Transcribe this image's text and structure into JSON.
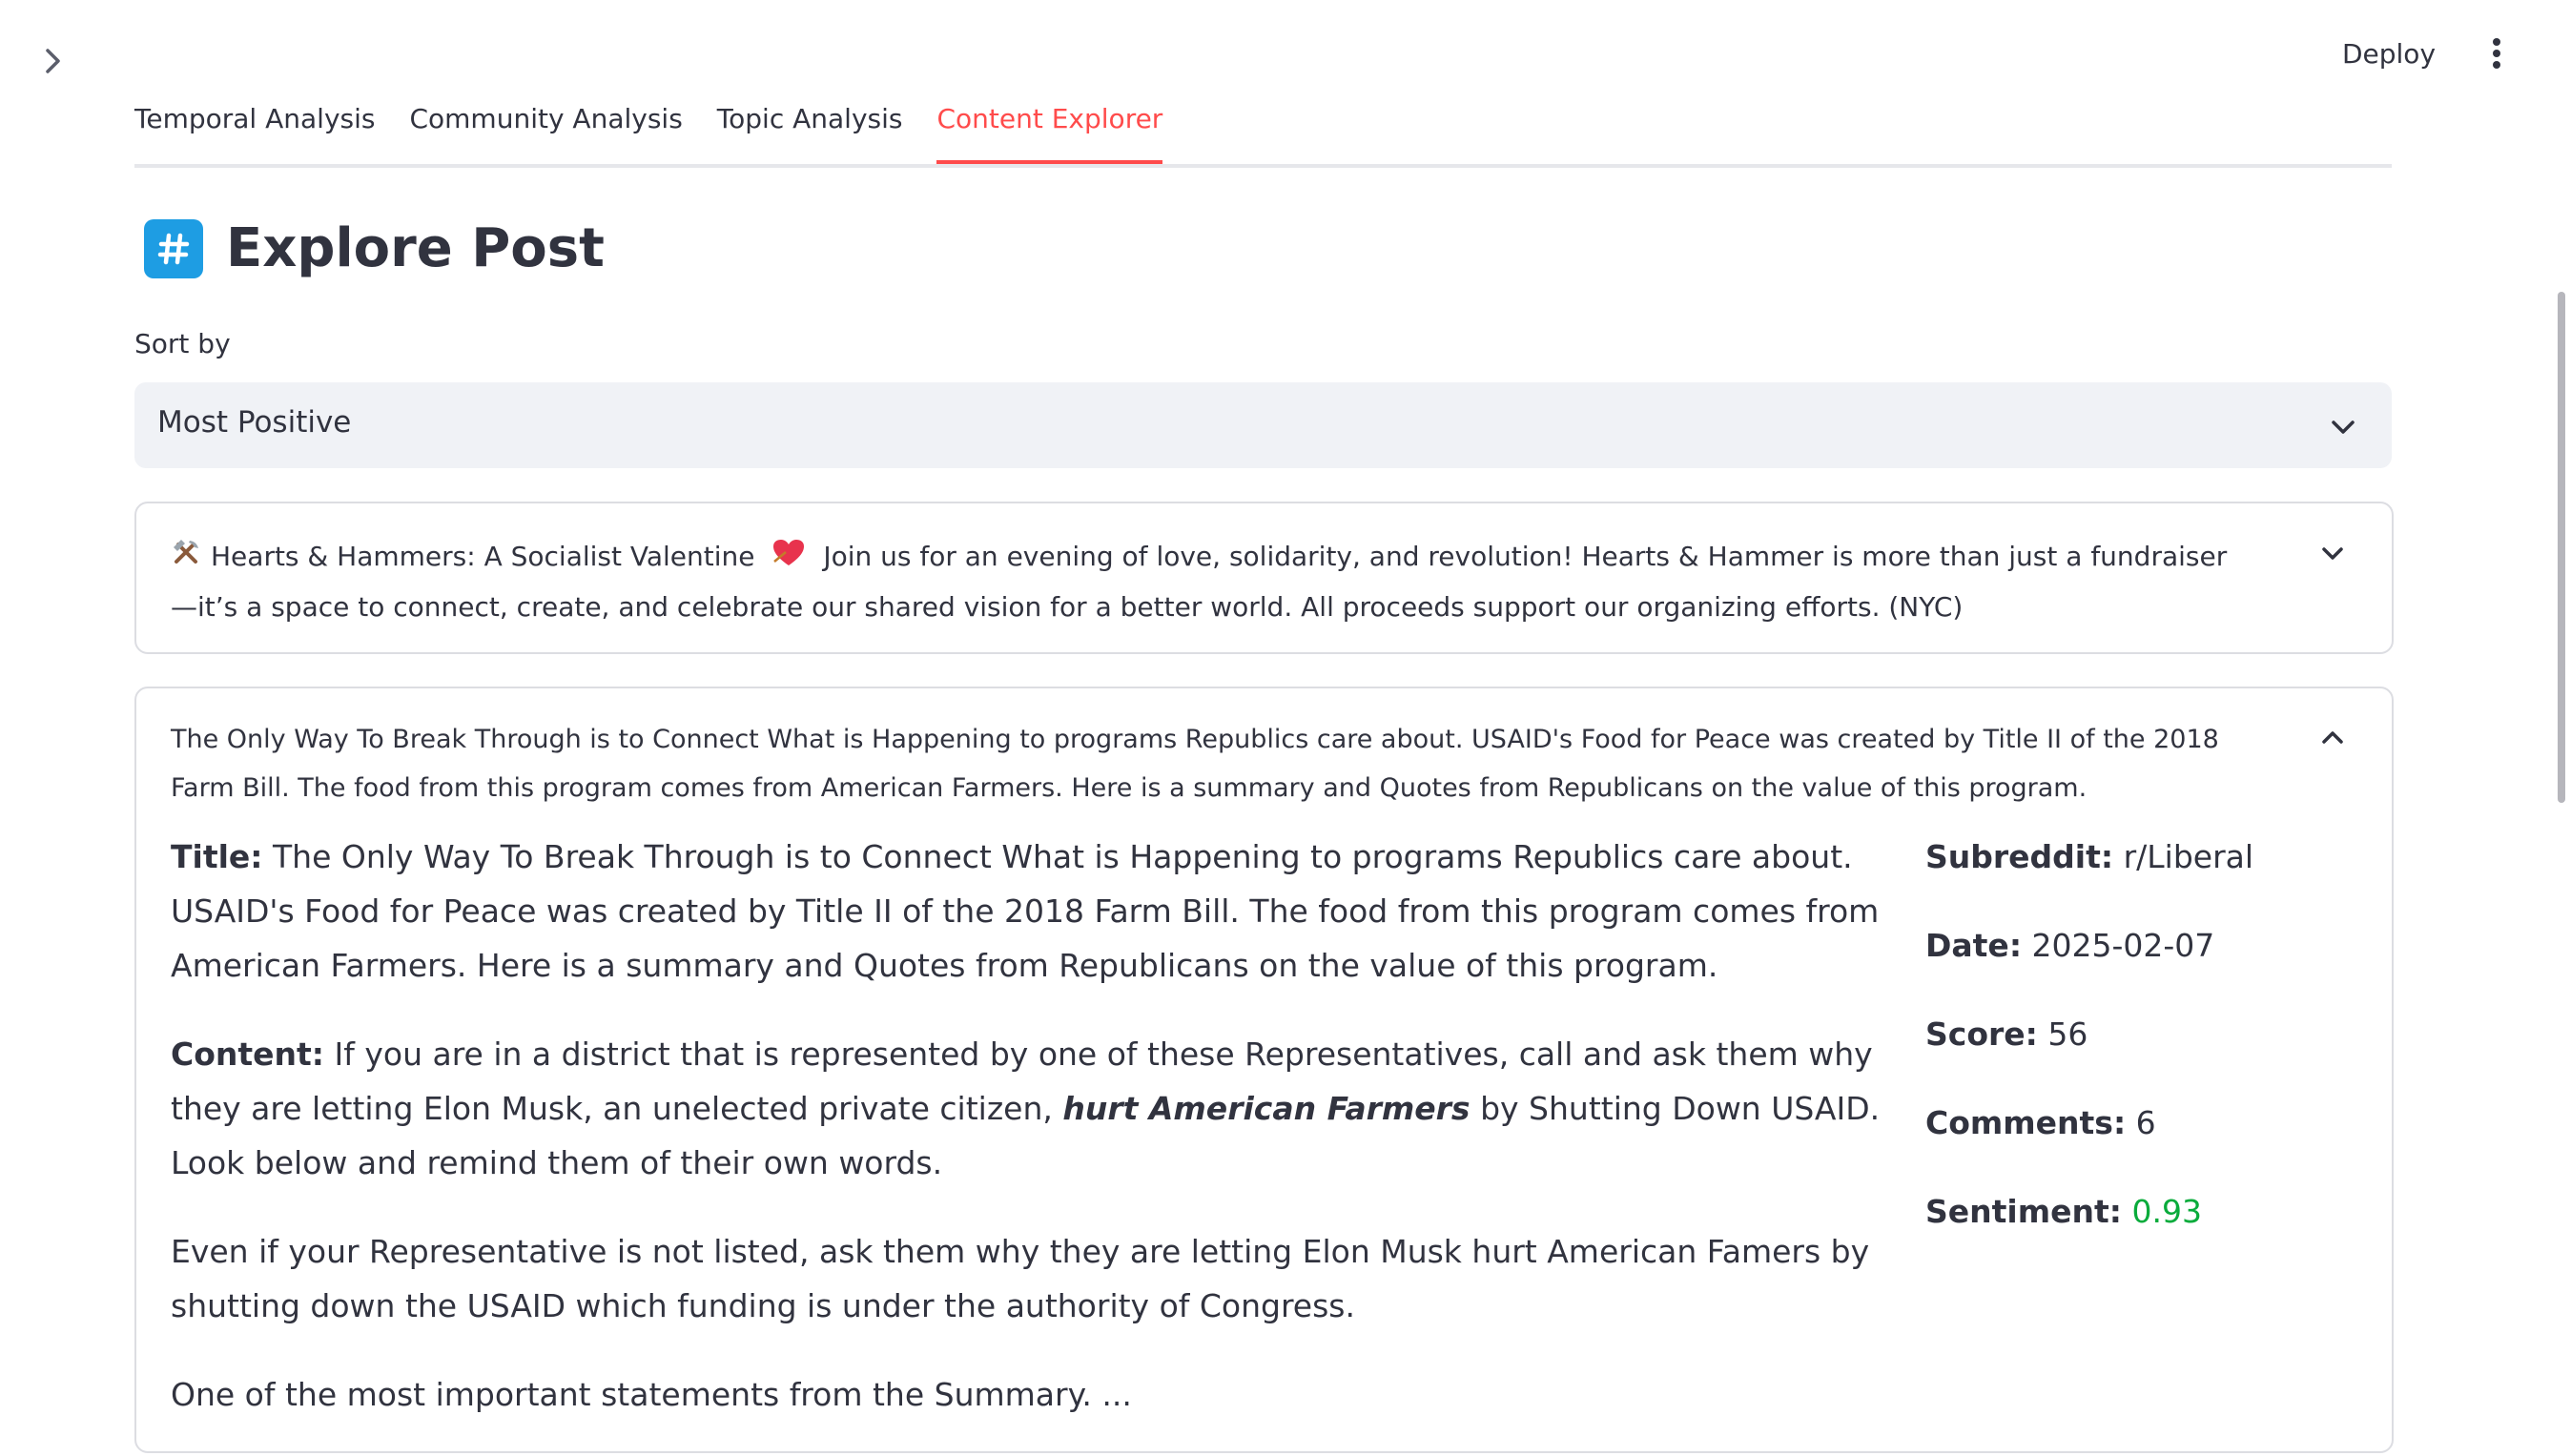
{
  "header": {
    "deploy_label": "Deploy",
    "icons": [
      "chevron-right-icon",
      "more-vertical-icon"
    ]
  },
  "tabs": [
    {
      "label": "Temporal Analysis",
      "active": false
    },
    {
      "label": "Community Analysis",
      "active": false
    },
    {
      "label": "Topic Analysis",
      "active": false
    },
    {
      "label": "Content Explorer",
      "active": true
    }
  ],
  "page": {
    "title": "Explore Post",
    "title_icon": "hash-icon",
    "accent_color": "#ff4b4b",
    "icon_color": "#1e9de3"
  },
  "sort": {
    "label": "Sort by",
    "selected": "Most Positive"
  },
  "posts": [
    {
      "header": "Hearts & Hammers: A Socialist Valentine",
      "header_rest": "Join us for an evening of love, solidarity, and revolution! Hearts & Hammer is more than just a fundraiser—it’s a space to connect, create, and celebrate our shared vision for a better world. All proceeds support our organizing efforts. (NYC)",
      "leading_icon": "hammer-pick-icon",
      "trailing_icon": "heart-icon",
      "expanded": false
    },
    {
      "header": "The Only Way To Break Through is to Connect What is Happening to programs Republics care about. USAID's Food for Peace was created by Title II of the 2018 Farm Bill. The food from this program comes from American Farmers. Here is a summary and Quotes from Republicans on the value of this program.",
      "expanded": true,
      "details": {
        "title_label": "Title:",
        "title": "The Only Way To Break Through is to Connect What is Happening to programs Republics care about. USAID's Food for Peace was created by Title II of the 2018 Farm Bill. The food from this program comes from American Farmers. Here is a summary and Quotes from Republicans on the value of this program.",
        "content_label": "Content:",
        "content_part1": "If you are in a district that is represented by one of these Representatives, call and ask them why they are letting Elon Musk, an unelected private citizen,",
        "content_emphasis": "hurt American Farmers",
        "content_part2": "by Shutting Down USAID. Look below and remind them of their own words.",
        "paragraph2": "Even if your Representative is not listed, ask them why they are letting Elon Musk hurt American Famers by shutting down the USAID which funding is under the authority of Congress.",
        "paragraph3": "One of the most important statements from the Summary. ...",
        "meta": {
          "subreddit_label": "Subreddit:",
          "subreddit": "r/Liberal",
          "date_label": "Date:",
          "date": "2025-02-07",
          "score_label": "Score:",
          "score": "56",
          "comments_label": "Comments:",
          "comments": "6",
          "sentiment_label": "Sentiment:",
          "sentiment": "0.93",
          "sentiment_color": "#09ab3b"
        }
      }
    }
  ]
}
